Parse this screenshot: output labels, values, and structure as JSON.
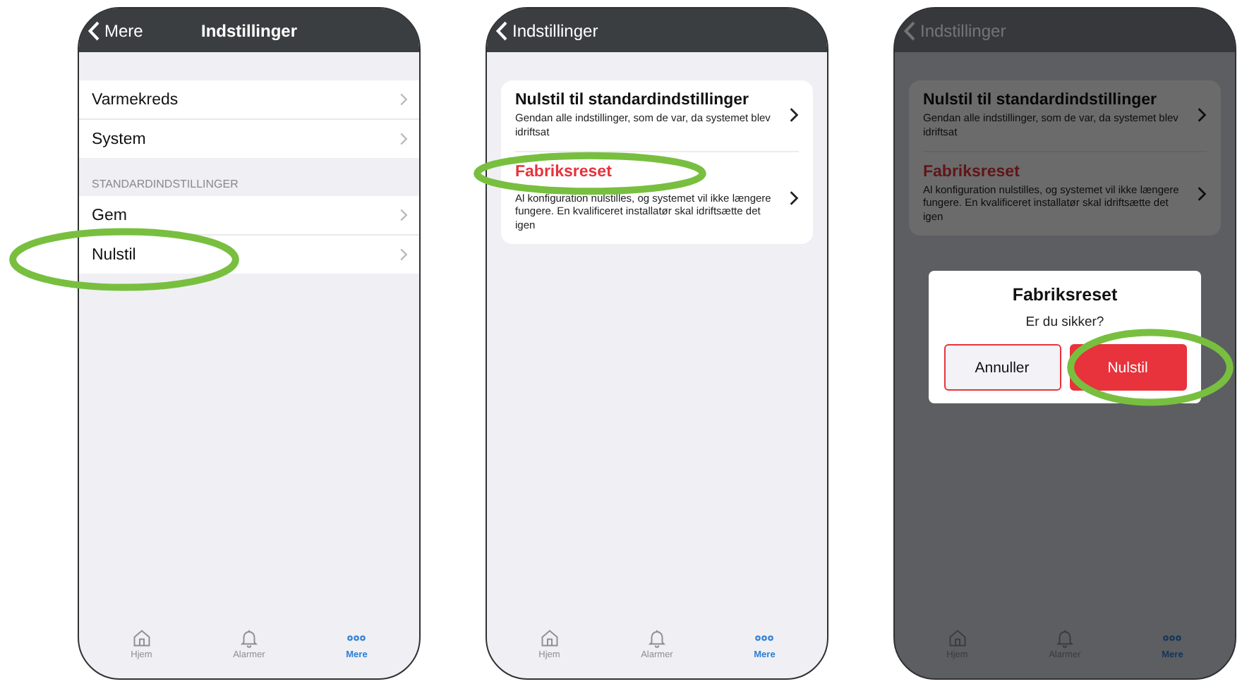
{
  "phones": [
    {
      "header": {
        "back": "Mere",
        "title": "Indstillinger"
      },
      "kind": "list",
      "sections": [
        {
          "items": [
            {
              "label": "Varmekreds",
              "circled": false
            },
            {
              "label": "System",
              "circled": false
            }
          ]
        },
        {
          "title": "STANDARDINDSTILLINGER",
          "items": [
            {
              "label": "Gem",
              "circled": false
            },
            {
              "label": "Nulstil",
              "circled": true
            }
          ]
        }
      ],
      "tabs": [
        {
          "label": "Hjem",
          "selected": false
        },
        {
          "label": "Alarmer",
          "selected": false
        },
        {
          "label": "Mere",
          "selected": true
        }
      ]
    },
    {
      "header": {
        "back": "Indstillinger"
      },
      "kind": "cards",
      "cards": [
        {
          "title": "Nulstil til standardindstillinger",
          "description": "Gendan alle indstillinger, som de var, da systemet blev idriftsat",
          "kind": "normal",
          "circled": false
        },
        {
          "title": "Fabriksreset",
          "description": "Al konfiguration nulstilles, og systemet vil ikke længere fungere. En kvalificeret installatør skal idriftsætte det igen",
          "kind": "danger",
          "circled": true
        }
      ],
      "tabs": [
        {
          "label": "Hjem",
          "selected": false
        },
        {
          "label": "Alarmer",
          "selected": false
        },
        {
          "label": "Mere",
          "selected": true
        }
      ]
    },
    {
      "header": {
        "back": "Indstillinger"
      },
      "kind": "cards",
      "cards": [
        {
          "title": "Nulstil til standardindstillinger",
          "description": "Gendan alle indstillinger, som de var, da systemet blev idriftsat",
          "kind": "normal",
          "circled": false
        },
        {
          "title": "Fabriksreset",
          "description": "Al konfiguration nulstilles, og systemet vil ikke længere fungere. En kvalificeret installatør skal idriftsætte det igen",
          "kind": "danger",
          "circled": false
        }
      ],
      "dialog": {
        "title": "Fabriksreset",
        "message": "Er du sikker?",
        "buttons": [
          {
            "label": "Annuller",
            "kind": "cancel",
            "circled": false
          },
          {
            "label": "Nulstil",
            "kind": "danger",
            "circled": true
          }
        ]
      },
      "tabs": [
        {
          "label": "Hjem",
          "selected": false
        },
        {
          "label": "Alarmer",
          "selected": false
        },
        {
          "label": "Mere",
          "selected": true
        }
      ]
    }
  ]
}
